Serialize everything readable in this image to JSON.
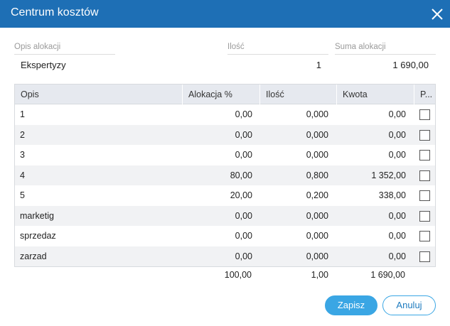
{
  "dialog": {
    "title": "Centrum kosztów",
    "close_icon": "close-icon"
  },
  "header": {
    "description_label": "Opis alokacji",
    "description_value": "Ekspertyzy",
    "quantity_label": "Ilość",
    "quantity_value": "1",
    "sum_label": "Suma alokacji",
    "sum_value": "1 690,00"
  },
  "table": {
    "columns": [
      "Opis",
      "Alokacja %",
      "Ilość",
      "Kwota",
      "P..."
    ],
    "rows": [
      {
        "opis": "1",
        "alokacja": "0,00",
        "ilosc": "0,000",
        "kwota": "0,00",
        "checked": false
      },
      {
        "opis": "2",
        "alokacja": "0,00",
        "ilosc": "0,000",
        "kwota": "0,00",
        "checked": false
      },
      {
        "opis": "3",
        "alokacja": "0,00",
        "ilosc": "0,000",
        "kwota": "0,00",
        "checked": false
      },
      {
        "opis": "4",
        "alokacja": "80,00",
        "ilosc": "0,800",
        "kwota": "1 352,00",
        "checked": false
      },
      {
        "opis": "5",
        "alokacja": "20,00",
        "ilosc": "0,200",
        "kwota": "338,00",
        "checked": false
      },
      {
        "opis": "marketig",
        "alokacja": "0,00",
        "ilosc": "0,000",
        "kwota": "0,00",
        "checked": false
      },
      {
        "opis": "sprzedaz",
        "alokacja": "0,00",
        "ilosc": "0,000",
        "kwota": "0,00",
        "checked": false
      },
      {
        "opis": "zarzad",
        "alokacja": "0,00",
        "ilosc": "0,000",
        "kwota": "0,00",
        "checked": false
      }
    ],
    "totals": {
      "alokacja": "100,00",
      "ilosc": "1,00",
      "kwota": "1 690,00"
    }
  },
  "buttons": {
    "save": "Zapisz",
    "cancel": "Anuluj"
  },
  "colors": {
    "titlebar": "#1e6fb5",
    "accent": "#3aa6e4"
  }
}
